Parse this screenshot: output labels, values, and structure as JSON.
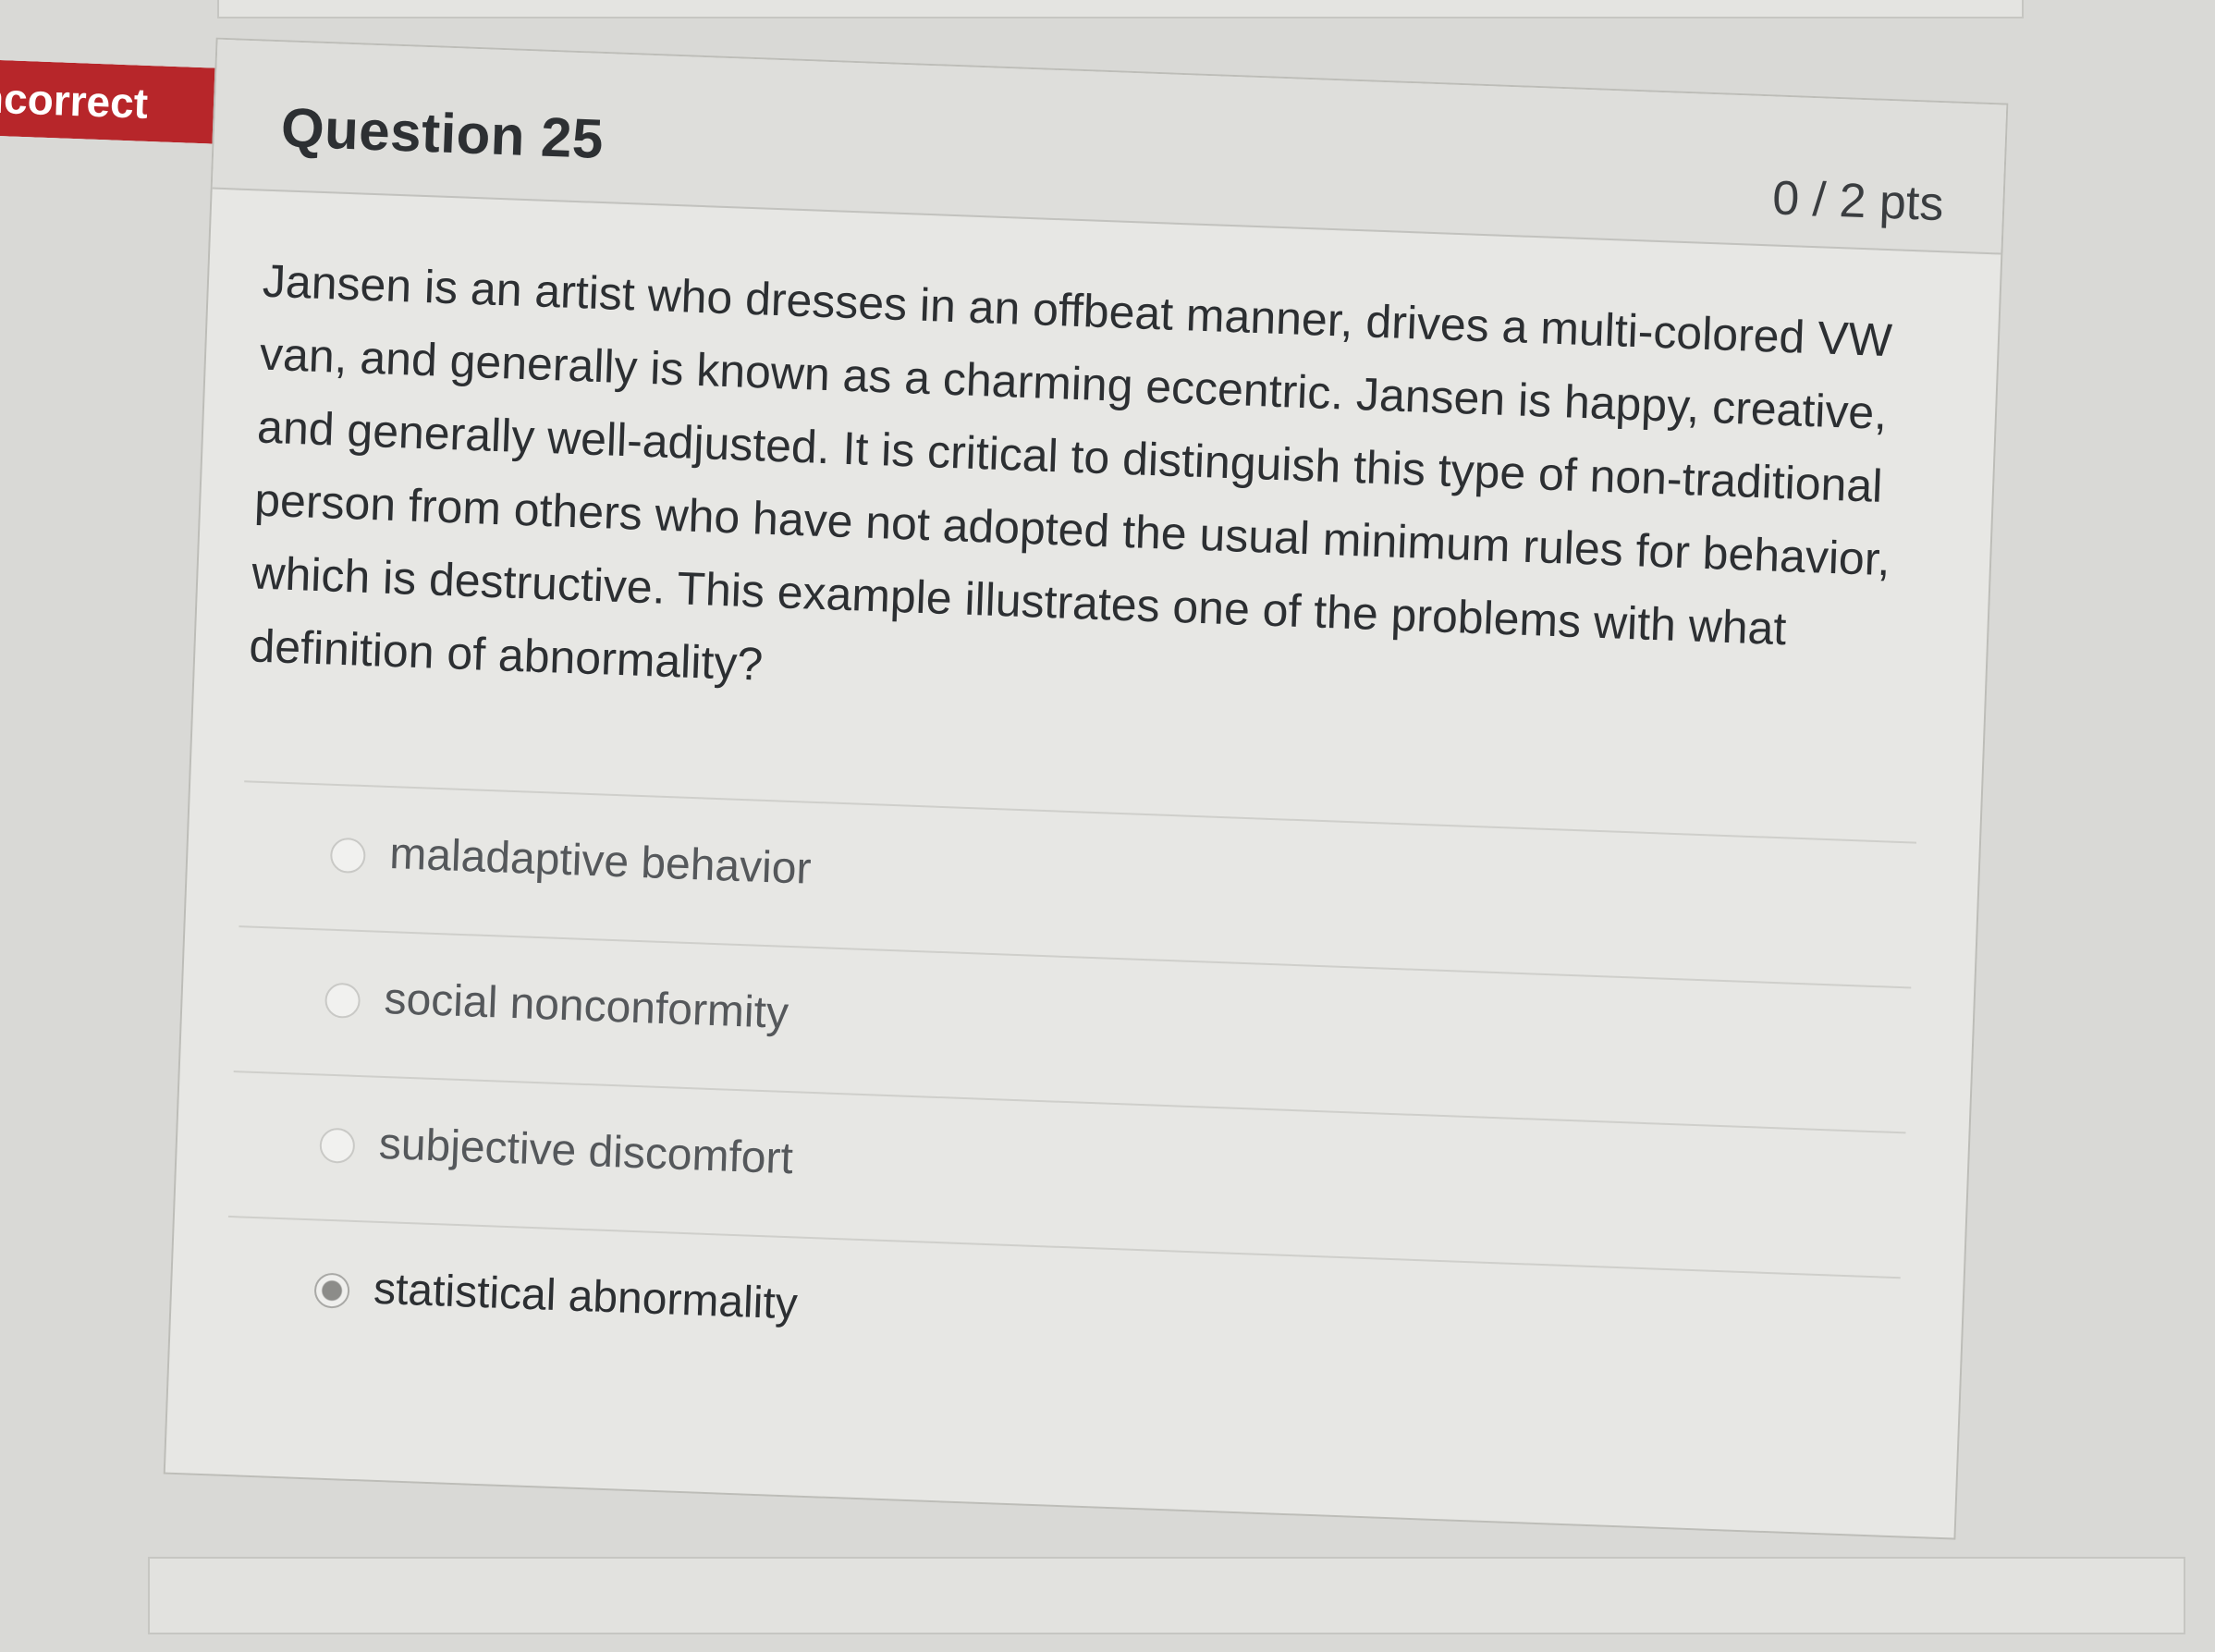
{
  "status": {
    "label": "ncorrect",
    "color": "#b7262a"
  },
  "question": {
    "title": "Question 25",
    "points": "0 / 2 pts",
    "text": "Jansen is an artist who dresses in an offbeat manner, drives a multi-colored VW van, and generally is known as a charming eccentric. Jansen is happy, creative, and generally well-adjusted. It is critical to distinguish this type of non-traditional person from others who have not adopted the usual minimum rules for behavior, which is destructive. This example illustrates one of the problems with what definition of abnormality?"
  },
  "answers": [
    {
      "label": "maladaptive behavior",
      "selected": false
    },
    {
      "label": "social nonconformity",
      "selected": false
    },
    {
      "label": "subjective discomfort",
      "selected": false
    },
    {
      "label": "statistical abnormality",
      "selected": true
    }
  ]
}
